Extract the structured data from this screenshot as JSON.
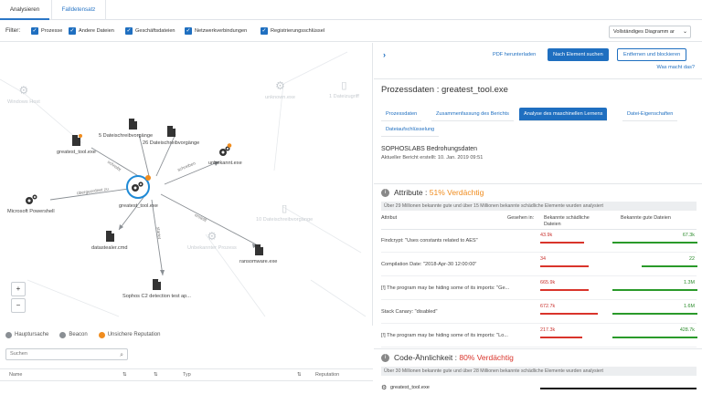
{
  "tabs": [
    {
      "label": "Analysieren",
      "active": true
    },
    {
      "label": "Falldetensatz",
      "active": false
    }
  ],
  "filter": {
    "label": "Filter:",
    "options": [
      {
        "label": "Prozesse",
        "checked": true
      },
      {
        "label": "Andere Dateien",
        "checked": true
      },
      {
        "label": "Geschäftsdateien",
        "checked": true
      },
      {
        "label": "Netzwerkverbindungen",
        "checked": true
      },
      {
        "label": "Registrierungsschlüssel",
        "checked": true
      }
    ],
    "diagram_select": "Vollständiges Diagramm ar"
  },
  "graph": {
    "nodes": {
      "center": "greatest_tool.exe",
      "powershell": "Microsoft Powershell",
      "tool_left": "greatest_tool.exe",
      "writes5": "5 Dateischreibvorgänge",
      "writes26": "26 Dateischreibvorgänge",
      "unknown": "unbekannt.exe",
      "datastealer": "datastealer.cmd",
      "c2": "Sophos C2 detection test ap...",
      "ransom": "ransomware.exe",
      "faded_1": "Windows Host",
      "faded_2": "unknown.exe",
      "faded_3": "1 Dateizugriff",
      "faded_4": "10 Dateischreibvorgänge",
      "faded_5": "Unbekannter Prozess"
    },
    "edges": {
      "e1": "übergeordnet zu",
      "e2": "schreibt",
      "e3": "liest",
      "e4": "schreiben",
      "e5": "erstellt",
      "e6": "startet"
    }
  },
  "legend": [
    {
      "label": "Hauptursache",
      "color": "#8a8f94"
    },
    {
      "label": "Beacon",
      "color": "#8a8f94"
    },
    {
      "label": "Unsichere Reputation",
      "color": "#f08c1e"
    }
  ],
  "search": {
    "placeholder": "Suchen"
  },
  "table": {
    "headers": [
      "Name",
      "Typ",
      "Reputation"
    ]
  },
  "right": {
    "pdf_link": "PDF herunterladen",
    "search_button": "Nach Element suchen",
    "remove_button": "Entfernen und blockieren",
    "help_link": "Was macht das?",
    "title": "Prozessdaten : greatest_tool.exe",
    "subtabs": [
      {
        "label": "Prozessdaten",
        "active": false
      },
      {
        "label": "Zusammenfassung des Berichts",
        "active": false
      },
      {
        "label": "Analyse des maschinellen Lernens",
        "active": true
      },
      {
        "label": "Datei-Eigenschaften",
        "active": false
      },
      {
        "label": "Dateiaufschlüsselung",
        "active": false
      }
    ],
    "sophoslabs_title": "SOPHOSLABS Bedrohungsdaten",
    "sophoslabs_sub": "Aktueller Bericht erstellt: 10. Jan. 2019 09:51",
    "attribute_section": {
      "title": "Attribute : ",
      "verdict": "51% Verdächtig",
      "verdict_color": "#f08c1e",
      "note": "Über 29 Millionen bekannte gute und über 15 Millionen bekannte schädliche Elemente wurden analysiert",
      "col_attr": "Attribut",
      "col_seen": "Gesehen in:",
      "col_bad": "Bekannte schädliche Dateien",
      "col_good": "Bekannte gute Dateien",
      "rows": [
        {
          "name": "Findcrypt: \"Uses constants related to AES\"",
          "bad": "43.9k",
          "good": "67.3k",
          "bad_frac": 0.52,
          "good_frac": 0.95
        },
        {
          "name": "Compilation Date: \"2018-Apr-30 12:00:00\"",
          "bad": "34",
          "good": "22",
          "bad_frac": 0.58,
          "good_frac": 0.62
        },
        {
          "name": "[!] The program may be hiding some of its imports: \"Ge...",
          "bad": "665.9k",
          "good": "1.3M",
          "bad_frac": 0.58,
          "good_frac": 0.95
        },
        {
          "name": "Stack Canary: \"disabled\"",
          "bad": "672.7k",
          "good": "1.6M",
          "bad_frac": 0.68,
          "good_frac": 0.95
        },
        {
          "name": "[!] The program may be hiding some of its imports: \"Lo...",
          "bad": "217.3k",
          "good": "428.7k",
          "bad_frac": 0.5,
          "good_frac": 0.95
        }
      ]
    },
    "code_section": {
      "title": "Code-Ähnlichkeit : ",
      "verdict": "80% Verdächtig",
      "verdict_color": "#d9342b",
      "note": "Über 30 Millionen bekannte gute und über 28 Millionen bekannte schädliche Elemente wurden analysiert",
      "row_name": "greatest_tool.exe"
    }
  },
  "colors": {
    "accent": "#1f6fc0",
    "bad": "#d9342b",
    "good": "#2a9a2a"
  }
}
